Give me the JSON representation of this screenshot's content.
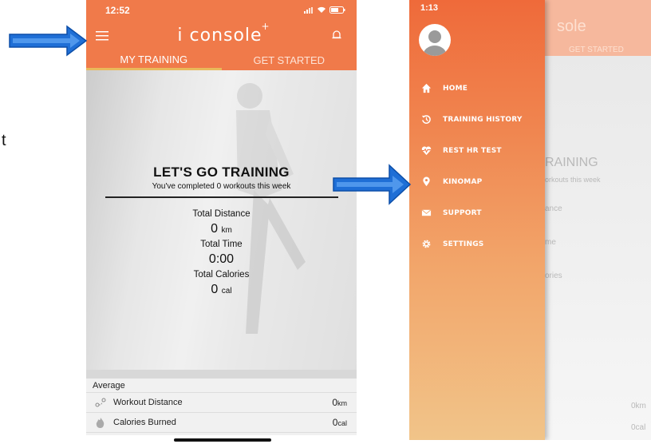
{
  "stray_text": "t",
  "left": {
    "status": {
      "time": "12:52"
    },
    "appbar": {
      "brand": "i console",
      "brand_sup": "+"
    },
    "tabs": [
      {
        "label": "MY TRAINING"
      },
      {
        "label": "GET STARTED"
      }
    ],
    "hero": {
      "title": "LET'S GO TRAINING",
      "subtitle": "You've completed 0 workouts this week"
    },
    "stats": [
      {
        "label": "Total Distance",
        "value": "0",
        "unit": "km"
      },
      {
        "label": "Total Time",
        "value": "0:00",
        "unit": ""
      },
      {
        "label": "Total Calories",
        "value": "0",
        "unit": "cal"
      }
    ],
    "average": {
      "heading": "Average",
      "rows": [
        {
          "label": "Workout Distance",
          "value": "0",
          "unit": "km",
          "icon": "route-icon"
        },
        {
          "label": "Calories Burned",
          "value": "0",
          "unit": "cal",
          "icon": "flame-icon"
        }
      ]
    }
  },
  "right": {
    "status": {
      "time": "1:13"
    },
    "menu": [
      {
        "label": "HOME",
        "icon": "home-icon"
      },
      {
        "label": "TRAINING HISTORY",
        "icon": "history-icon"
      },
      {
        "label": "REST HR TEST",
        "icon": "heart-rate-icon"
      },
      {
        "label": "KINOMAP",
        "icon": "map-pin-icon"
      },
      {
        "label": "SUPPORT",
        "icon": "mail-icon"
      },
      {
        "label": "SETTINGS",
        "icon": "gear-icon"
      }
    ],
    "background_ghost": {
      "brand": "sole",
      "tab": "GET STARTED",
      "title": "RAINING",
      "subtitle": "orkouts this week",
      "label1": "ance",
      "label2": "me",
      "label3": "ories",
      "val1": "0km",
      "val2": "0cal"
    }
  },
  "colors": {
    "orange": "#f07a4a",
    "tab_underline": "#e9b95b",
    "arrow_blue": "#1f6fd6"
  }
}
